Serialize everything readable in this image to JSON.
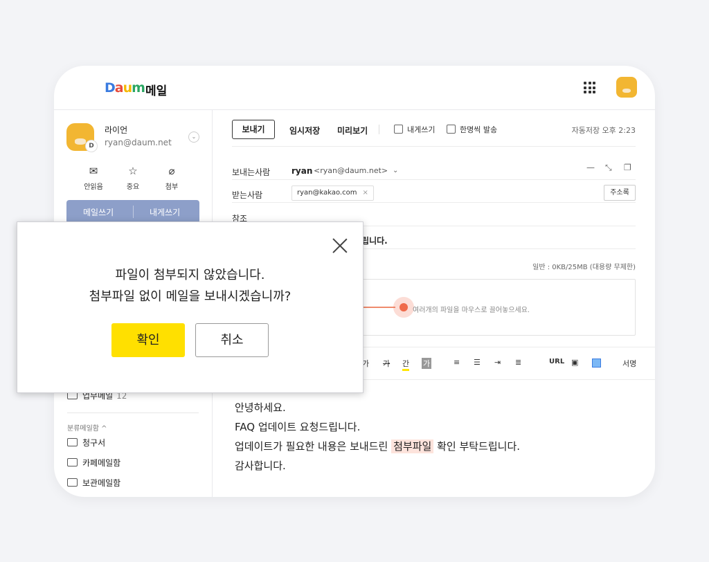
{
  "header": {
    "logo_daum": "Daum",
    "logo_text": "메일"
  },
  "sidebar": {
    "user_name": "라이언",
    "user_email": "ryan@daum.net",
    "badge": "D",
    "quick": [
      {
        "label": "안읽음",
        "icon": "✉"
      },
      {
        "label": "중요",
        "icon": "☆"
      },
      {
        "label": "첨부",
        "icon": "⌀"
      }
    ],
    "compose": "메일쓰기",
    "self_compose": "내게쓰기",
    "folders": [
      {
        "name": "업무메일",
        "count": "12"
      }
    ],
    "category_header": "분류메일함 ^",
    "category_folders": [
      "청구서",
      "카페메일함",
      "보관메일함"
    ]
  },
  "toolbar": {
    "send": "보내기",
    "save_draft": "임시저장",
    "preview": "미리보기",
    "self_mail": "내게쓰기",
    "individual_send": "한명씩 발송",
    "autosave": "자동저장 오후 2:23"
  },
  "form": {
    "sender_label": "보내는사람",
    "sender_name": "ryan",
    "sender_email": "<ryan@daum.net>",
    "recipient_label": "받는사람",
    "recipient_chip": "ryan@kakao.com",
    "address_book": "주소록",
    "cc_label": "참조",
    "subject_tail": "드립니다.",
    "attachment_info": "일반 : 0KB/25MB (대용량 무제한)",
    "dropzone_text": "여러개의 파일을 마우스로 끌어놓으세요."
  },
  "editor": {
    "tools": [
      "가",
      "가",
      "간",
      "가",
      "URL"
    ],
    "signature": "서명"
  },
  "body": {
    "line1": "안녕하세요.",
    "line2": "FAQ 업데이트 요청드립니다.",
    "line3_pre": "업데이트가 필요한 내용은 보내드린",
    "line3_mark": "첨부파일",
    "line3_post": "확인 부탁드립니다.",
    "line4": "감사합니다."
  },
  "dialog": {
    "line1": "파일이 첨부되지 않았습니다.",
    "line2": "첨부파일 없이 메일을 보내시겠습니까?",
    "confirm": "확인",
    "cancel": "취소"
  },
  "colors": {
    "accent_yellow": "#ffe000",
    "compose_bar": "#8d9fc9",
    "drop_dot": "#ef6a4a"
  }
}
